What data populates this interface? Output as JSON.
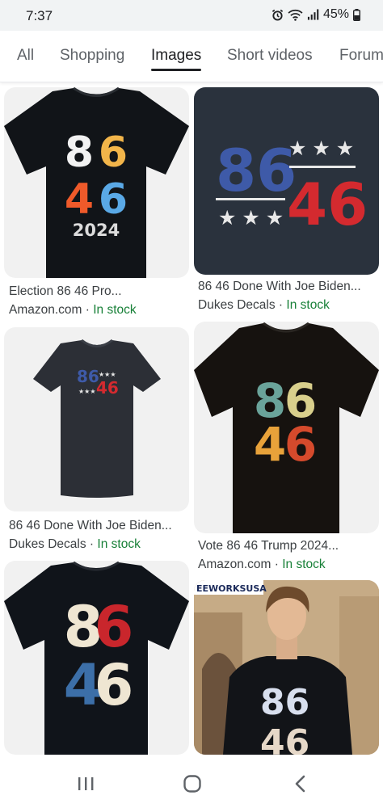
{
  "status": {
    "time": "7:37",
    "battery": "45%"
  },
  "tabs": [
    {
      "label": "All"
    },
    {
      "label": "Shopping"
    },
    {
      "label": "Images"
    },
    {
      "label": "Short videos"
    },
    {
      "label": "Forum"
    }
  ],
  "results": [
    {
      "title": "Election 86 46 Pro...",
      "source": "Amazon.com",
      "sep": " · ",
      "stock": "In stock",
      "print_top": "86",
      "print_bottom": "46",
      "print_extra": "2024"
    },
    {
      "title": "86 46 Done With Joe Biden...",
      "source": "Dukes Decals",
      "sep": " · ",
      "stock": "In stock",
      "print_top": "86",
      "print_bottom": "46"
    },
    {
      "title": "86 46 Done With Joe Biden...",
      "source": "Dukes Decals",
      "sep": " · ",
      "stock": "In stock",
      "print_top": "86",
      "print_bottom": "46"
    },
    {
      "title": "Vote 86 46 Trump 2024...",
      "source": "Amazon.com",
      "sep": " · ",
      "stock": "In stock",
      "print_top": "86",
      "print_bottom": "46"
    },
    {
      "print_top": "86",
      "print_bottom": "46"
    },
    {
      "brand": "EEWORKSUSA",
      "print_top": "86",
      "print_bottom": "46"
    }
  ],
  "colors": {
    "in_stock": "#188038",
    "tab_active": "#202124",
    "tab_inactive": "#5f6368"
  }
}
